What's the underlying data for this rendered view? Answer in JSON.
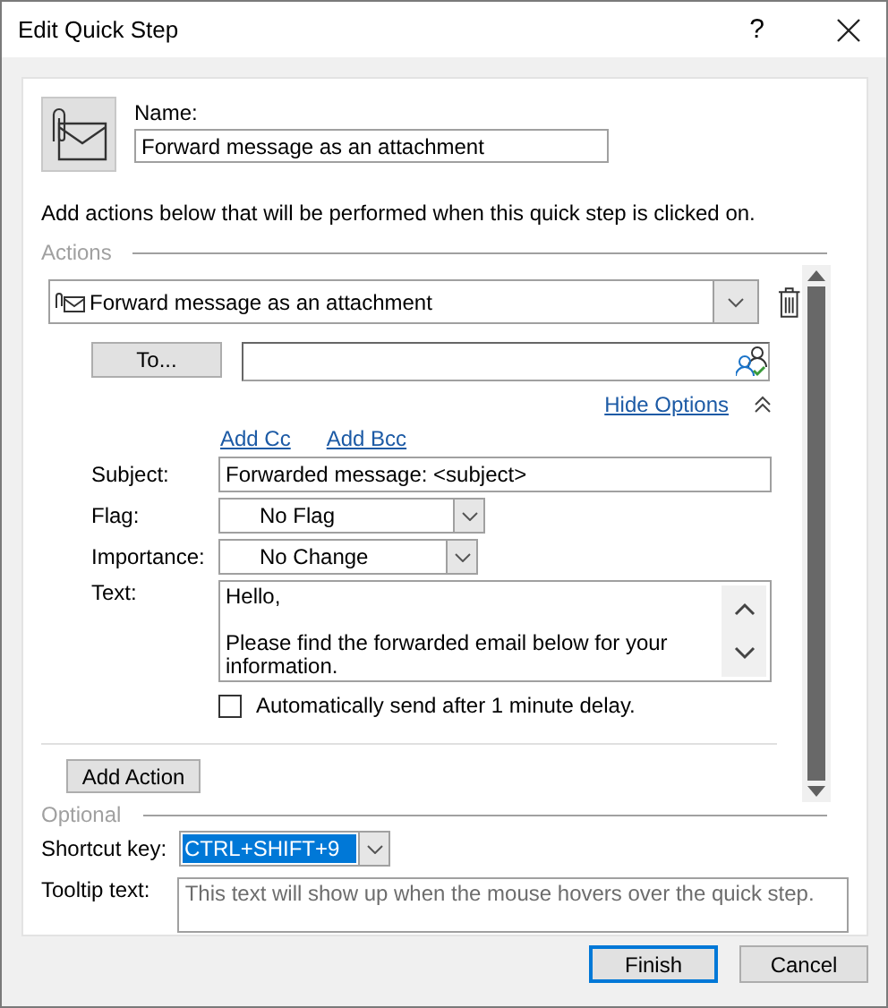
{
  "window": {
    "title": "Edit Quick Step",
    "help": "?"
  },
  "name": {
    "label": "Name:",
    "value": "Forward message as an attachment"
  },
  "instructions": "Add actions below that will be performed when this quick step is clicked on.",
  "actions": {
    "legend": "Actions",
    "action": {
      "value": "Forward message as an attachment"
    },
    "to_button": "To...",
    "hide_options": "Hide Options",
    "add_cc": "Add Cc",
    "add_bcc": "Add Bcc",
    "subject": {
      "label": "Subject:",
      "value": "Forwarded message: <subject>"
    },
    "flag": {
      "label": "Flag:",
      "value": "No Flag"
    },
    "importance": {
      "label": "Importance:",
      "value": "No Change"
    },
    "text": {
      "label": "Text:",
      "value": "Hello,\n\nPlease find the forwarded email below for your information."
    },
    "auto_send": {
      "label": "Automatically send after 1 minute delay.",
      "checked": false
    },
    "add_action": "Add Action"
  },
  "optional": {
    "legend": "Optional",
    "shortcut": {
      "label": "Shortcut key:",
      "value": "CTRL+SHIFT+9",
      "selected": true
    },
    "tooltip": {
      "label": "Tooltip text:",
      "placeholder": "This text will show up when the mouse hovers over the quick step."
    }
  },
  "buttons": [
    {
      "label": "Finish",
      "default": true
    },
    {
      "label": "Cancel",
      "default": false
    }
  ]
}
